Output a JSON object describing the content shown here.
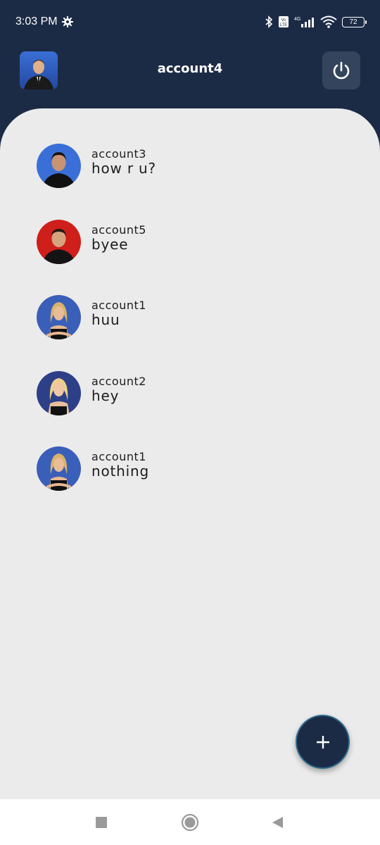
{
  "status_bar": {
    "time": "3:03 PM",
    "battery": "72",
    "network": "4G",
    "volte": "Vo LTE"
  },
  "header": {
    "title": "account4"
  },
  "chats": [
    {
      "name": "account3",
      "message": "how r u?"
    },
    {
      "name": "account5",
      "message": "byee"
    },
    {
      "name": "account1",
      "message": "huu"
    },
    {
      "name": "account2",
      "message": "hey"
    },
    {
      "name": "account1",
      "message": "nothing"
    }
  ],
  "icons": {
    "settings": "gear-icon",
    "bluetooth": "bluetooth-icon",
    "signal": "signal-icon",
    "wifi": "wifi-icon",
    "power": "power-icon",
    "fab": "plus-icon",
    "nav_recent": "square-icon",
    "nav_home": "circle-icon",
    "nav_back": "triangle-back-icon"
  },
  "colors": {
    "primary": "#1c2b45",
    "background": "#ebebeb",
    "fab_border": "#2f6d8f"
  }
}
